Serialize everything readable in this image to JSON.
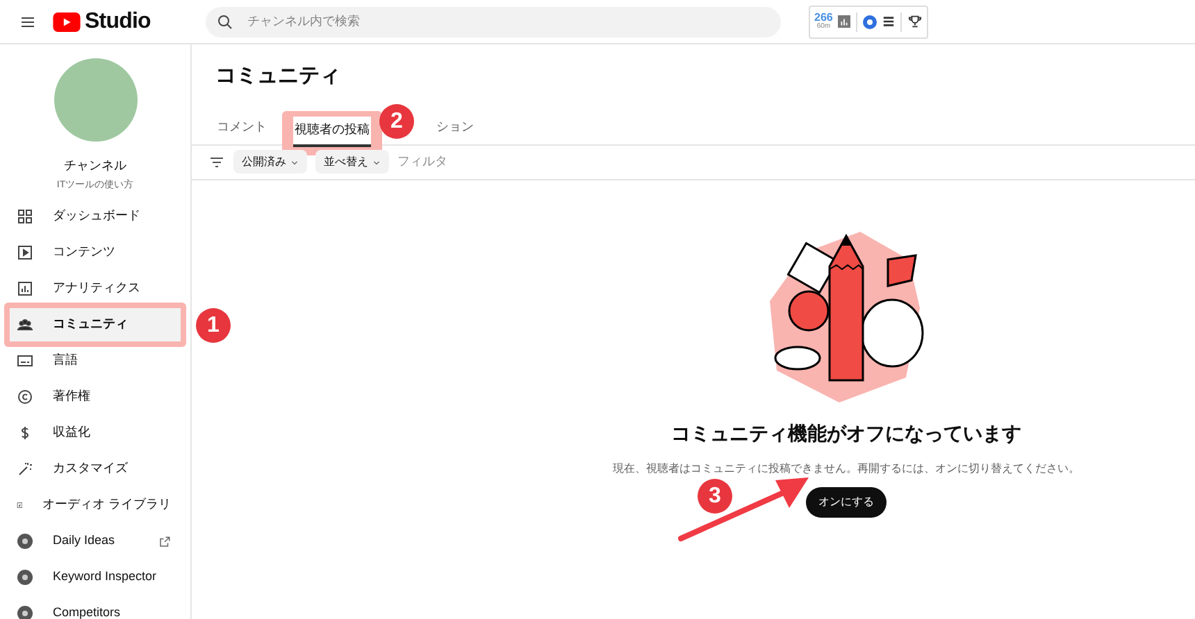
{
  "header": {
    "logo_text": "Studio",
    "search_placeholder": "チャンネル内で検索",
    "extension": {
      "count": "266",
      "sub": "60m"
    }
  },
  "sidebar": {
    "channel": {
      "label": "チャンネル",
      "subtitle": "ITツールの使い方"
    },
    "items": [
      {
        "label": "ダッシュボード",
        "selected": false,
        "external": false
      },
      {
        "label": "コンテンツ",
        "selected": false,
        "external": false
      },
      {
        "label": "アナリティクス",
        "selected": false,
        "external": false
      },
      {
        "label": "コミュニティ",
        "selected": true,
        "external": false
      },
      {
        "label": "言語",
        "selected": false,
        "external": false
      },
      {
        "label": "著作権",
        "selected": false,
        "external": false
      },
      {
        "label": "収益化",
        "selected": false,
        "external": false
      },
      {
        "label": "カスタマイズ",
        "selected": false,
        "external": false
      },
      {
        "label": "オーディオ ライブラリ",
        "selected": false,
        "external": false
      },
      {
        "label": "Daily Ideas",
        "selected": false,
        "external": true
      },
      {
        "label": "Keyword Inspector",
        "selected": false,
        "external": false
      },
      {
        "label": "Competitors",
        "selected": false,
        "external": false
      }
    ]
  },
  "page_title": "コミュニティ",
  "tabs": [
    {
      "label": "コメント",
      "selected": false
    },
    {
      "label": "視聴者の投稿",
      "selected": true
    },
    {
      "label": "ション",
      "selected": false
    }
  ],
  "filters": {
    "chips": [
      "公開済み",
      "並べ替え"
    ],
    "placeholder": "フィルタ"
  },
  "empty_state": {
    "title": "コミュニティ機能がオフになっています",
    "message": "現在、視聴者はコミュニティに投稿できません。再開するには、オンに切り替えてください。",
    "button": "オンにする"
  },
  "annotations": [
    "1",
    "2",
    "3"
  ]
}
